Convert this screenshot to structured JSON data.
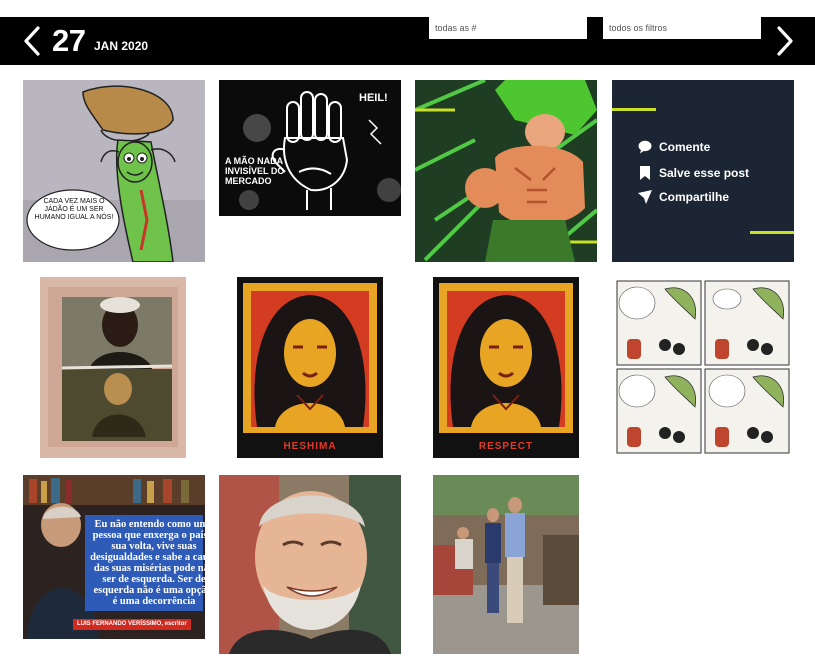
{
  "header": {
    "day": "27",
    "month_year": "JAN 2020",
    "prev_icon": "chevron-left-icon",
    "next_icon": "chevron-right-icon",
    "filters": [
      {
        "placeholder": "todas as #"
      },
      {
        "placeholder": "todos os filtros"
      }
    ]
  },
  "tiles": {
    "cartoon_speech": "CADA VEZ MAIS O JÁDÃO É UM SER HUMANO IGUAL A NÓS!",
    "hand_heil": "HEIL!",
    "hand_caption": "A MÃO NADA INVISÍVEL DO MERCADO",
    "share_card": {
      "items": [
        {
          "label": "Comente",
          "icon": "comment-icon"
        },
        {
          "label": "Salve esse post",
          "icon": "bookmark-icon"
        },
        {
          "label": "Compartilhe",
          "icon": "send-icon"
        }
      ],
      "accent_color": "#c9e02a",
      "background": "#1b2533"
    },
    "poster_1_caption": "HESHIMA",
    "poster_2_caption": "RESPECT",
    "quote_text": "Eu não entendo como uma pessoa que enxerga o país à sua volta, vive suas desigualdades e sabe a causa das suas misérias pode não ser de esquerda. Ser de esquerda não é uma opção, é uma decorrência",
    "quote_author": "LUIS FERNANDO VERÍSSIMO, escritor"
  }
}
